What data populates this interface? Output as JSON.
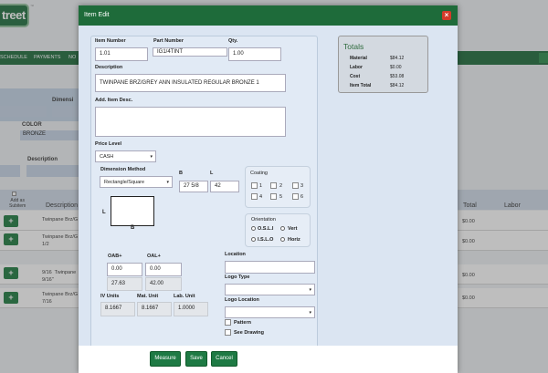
{
  "background": {
    "logo_text": "treet",
    "nav": [
      "SCHEDULE",
      "PAYMENTS",
      "NO"
    ],
    "search": {
      "dimension_label": "Dimensi",
      "color_label": "COLOR",
      "color_value": "BRONZE",
      "description_label": "Description"
    },
    "table": {
      "headers": {
        "add_as_subitem": "Add as\nSubitem",
        "description": "Description",
        "price_total": "Total",
        "labor": "Labor"
      },
      "rows": [
        {
          "desc": "Twinpane Brz/G",
          "price": "$0.00"
        },
        {
          "desc": "Twinpane Brz/G\n1/2",
          "price": "$0.00"
        },
        {
          "desc": "9/16  Twinpane\n9/16\"",
          "price": "$0.00"
        },
        {
          "desc": "Twinpane Brz/G\n7/16",
          "price": "$0.00"
        }
      ]
    }
  },
  "modal": {
    "title": "Item Edit",
    "item_number": {
      "label": "Item Number",
      "value": "1.01"
    },
    "part_number": {
      "label": "Part Number",
      "value": "IG1/4TINT"
    },
    "qty": {
      "label": "Qty.",
      "value": "1.00"
    },
    "description": {
      "label": "Description",
      "value": "TWINPANE BRZ/GREY ANN INSULATED REGULAR BRONZE 1"
    },
    "add_desc": {
      "label": "Add. Item Desc.",
      "value": ""
    },
    "price_level": {
      "label": "Price Level",
      "value": "CASH"
    },
    "dimension_method": {
      "label": "Dimension Method",
      "value": "Rectangle/Square"
    },
    "b_label": "B",
    "l_label": "L",
    "b_value": "27 5/8",
    "l_value": "42",
    "coating": {
      "label": "Coating",
      "options": [
        "1",
        "2",
        "3",
        "4",
        "5",
        "6"
      ]
    },
    "orientation": {
      "label": "Orientation",
      "options": [
        "O.S.L.I",
        "Vert",
        "I.S.L.O",
        "Horiz"
      ]
    },
    "diagram": {
      "l": "L",
      "b": "B"
    },
    "oab": {
      "label": "OAB+",
      "value": "0.00",
      "computed": "27.63"
    },
    "oal": {
      "label": "OAL+",
      "value": "0.00",
      "computed": "42.00"
    },
    "iv_units": {
      "label": "IV Units",
      "value": "8.1667"
    },
    "mat_unit": {
      "label": "Mat. Unit",
      "value": "8.1667"
    },
    "lab_unit": {
      "label": "Lab. Unit",
      "value": "1.0000"
    },
    "location": {
      "label": "Location",
      "value": ""
    },
    "logo_type": {
      "label": "Logo Type",
      "value": ""
    },
    "logo_location": {
      "label": "Logo Location",
      "value": ""
    },
    "pattern_label": "Pattern",
    "see_drawing_label": "See Drawing",
    "totals": {
      "title": "Totals",
      "material": {
        "label": "Material",
        "value": "$84.12"
      },
      "labor": {
        "label": "Labor",
        "value": "$0.00"
      },
      "cost": {
        "label": "Cost",
        "value": "$53.08"
      },
      "item_total": {
        "label": "Item Total",
        "value": "$84.12"
      }
    },
    "buttons": {
      "measure": "Measure",
      "save": "Save",
      "cancel": "Cancel"
    }
  }
}
